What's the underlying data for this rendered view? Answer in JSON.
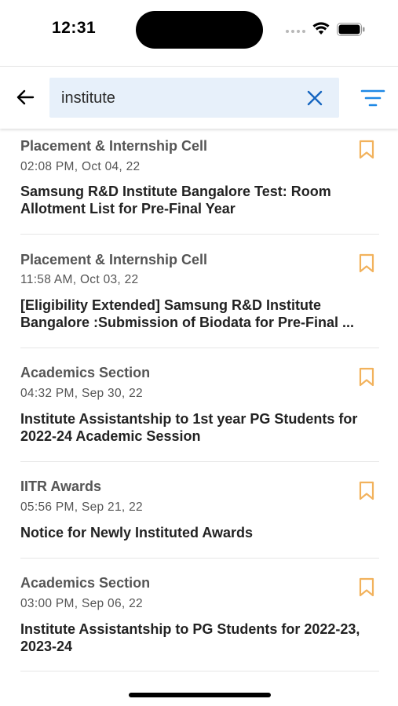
{
  "status_bar": {
    "time": "12:31"
  },
  "search": {
    "query": "institute",
    "back_icon": "arrow-left-icon",
    "clear_icon": "close-icon",
    "filter_icon": "filter-icon",
    "accent_color": "#1565c0"
  },
  "notices": [
    {
      "source": "Placement & Internship Cell",
      "date": "02:08 PM, Oct 04, 22",
      "title": "Samsung R&D Institute Bangalore Test: Room Allotment List for Pre-Final Year"
    },
    {
      "source": "Placement & Internship Cell",
      "date": "11:58 AM, Oct 03, 22",
      "title": "[Eligibility Extended] Samsung R&D Institute Bangalore :Submission of Biodata for Pre-Final ..."
    },
    {
      "source": "Academics Section",
      "date": "04:32 PM, Sep 30, 22",
      "title": "Institute Assistantship to 1st year PG Students for 2022-24 Academic Session"
    },
    {
      "source": "IITR Awards",
      "date": "05:56 PM, Sep 21, 22",
      "title": "Notice for Newly Instituted Awards"
    },
    {
      "source": "Academics Section",
      "date": "03:00 PM, Sep 06, 22",
      "title": "Institute Assistantship to PG Students for 2022-23, 2023-24"
    }
  ],
  "bookmark_color": "#f2b25c"
}
